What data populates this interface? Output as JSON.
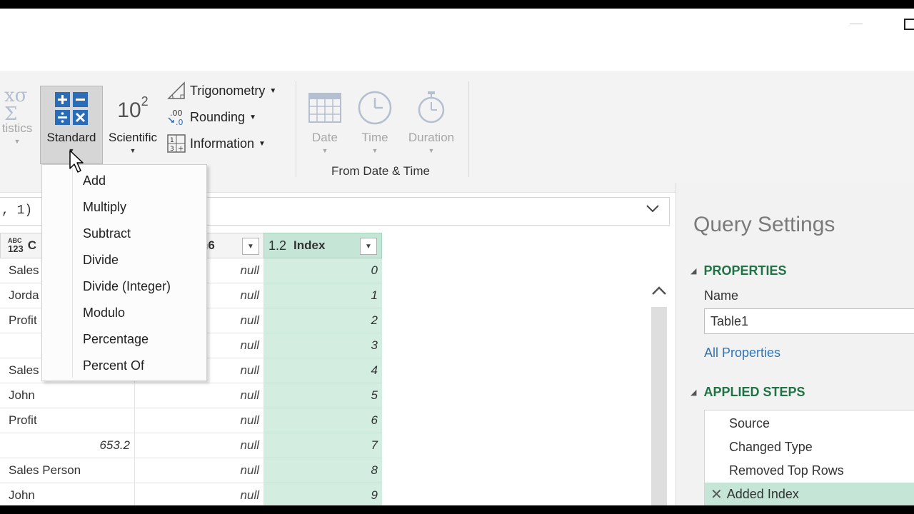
{
  "ribbon": {
    "buttons": {
      "statistics": "tistics",
      "standard": "Standard",
      "scientific": "Scientific",
      "scientific_glyph": "10",
      "scientific_exp": "2",
      "trigonometry": "Trigonometry",
      "rounding": "Rounding",
      "information": "Information",
      "date": "Date",
      "time": "Time",
      "duration": "Duration"
    },
    "groups": {
      "datetime": "From Date & Time"
    }
  },
  "formula_bar": {
    "text": ", 1)"
  },
  "grid": {
    "headers": {
      "col1_type": "ABC\n123",
      "col1_type_top": "ABC",
      "col1_type_bottom": "123",
      "col1": "C",
      "col2": "n6",
      "index_type": "1.2",
      "index": "Index"
    },
    "rows": [
      {
        "c1": "Sales",
        "c2": "null",
        "c3": "0"
      },
      {
        "c1": "Jorda",
        "c2": "null",
        "c3": "1"
      },
      {
        "c1": "Profit",
        "c2": "null",
        "c3": "2"
      },
      {
        "c1": "",
        "c2": "null",
        "c3": "3"
      },
      {
        "c1": "Sales Person",
        "c2": "null",
        "c3": "4"
      },
      {
        "c1": "John",
        "c2": "null",
        "c3": "5"
      },
      {
        "c1": "Profit",
        "c2": "null",
        "c3": "6"
      },
      {
        "c1": "653.2",
        "c2": "null",
        "c3": "7"
      },
      {
        "c1": "Sales Person",
        "c2": "null",
        "c3": "8"
      },
      {
        "c1": "John",
        "c2": "null",
        "c3": "9"
      }
    ]
  },
  "standard_menu": {
    "items": [
      "Add",
      "Multiply",
      "Subtract",
      "Divide",
      "Divide (Integer)",
      "Modulo",
      "Percentage",
      "Percent Of"
    ]
  },
  "query_settings": {
    "title": "Query Settings",
    "properties_heading": "PROPERTIES",
    "name_label": "Name",
    "name_value": "Table1",
    "all_properties": "All Properties",
    "steps_heading": "APPLIED STEPS",
    "steps": [
      "Source",
      "Changed Type",
      "Removed Top Rows",
      "Added Index"
    ],
    "active_step": "Added Index"
  },
  "colors": {
    "accent_green": "#217346",
    "index_col_bg": "#d3ede1",
    "active_step_bg": "#c5e6d6",
    "link_blue": "#2e75b6"
  }
}
